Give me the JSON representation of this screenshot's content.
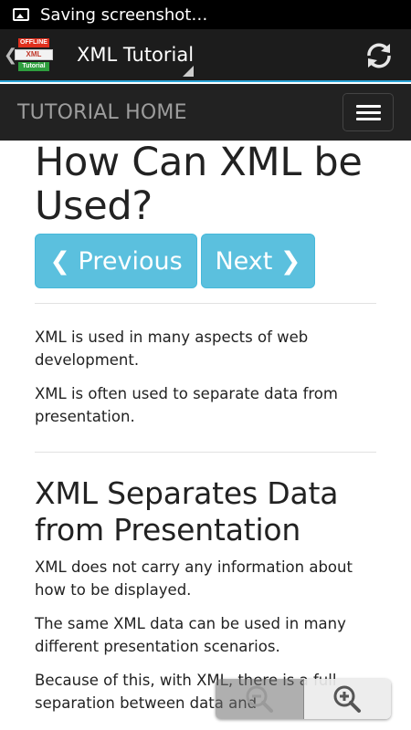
{
  "status_bar": {
    "text": "Saving screenshot…",
    "icon": "image-icon"
  },
  "action_bar": {
    "logo": {
      "top": "OFFLINE",
      "middle": "XML",
      "bottom": "Tutorial"
    },
    "title": "XML Tutorial",
    "refresh_icon": "refresh-icon"
  },
  "navbar": {
    "home_label": "TUTORIAL HOME",
    "menu_icon": "hamburger-menu-icon"
  },
  "content": {
    "title": "How Can XML be Used?",
    "prev_label": "❮ Previous",
    "next_label": "Next ❯",
    "intro": [
      "XML is used in many aspects of web development.",
      "XML is often used to separate data from presentation."
    ],
    "section_title": "XML Separates Data from Presentation",
    "section_paras": [
      "XML does not carry any information about how to be displayed.",
      "The same XML data can be used in many different presentation scenarios.",
      "Because of this, with XML, there is a full separation between data and"
    ]
  },
  "zoom": {
    "out_icon": "zoom-out-icon",
    "in_icon": "zoom-in-icon"
  },
  "colors": {
    "accent": "#2aa5d8",
    "button": "#5bc0de",
    "navbar": "#222222"
  }
}
